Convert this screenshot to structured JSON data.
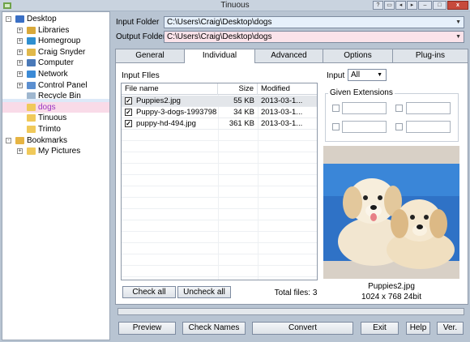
{
  "window": {
    "title": "Tinuous"
  },
  "tree": {
    "items": [
      {
        "label": "Desktop",
        "icon": "desktop-icon",
        "level": 0,
        "expander": "−"
      },
      {
        "label": "Libraries",
        "icon": "libraries-icon",
        "level": 1,
        "expander": "+"
      },
      {
        "label": "Homegroup",
        "icon": "homegroup-icon",
        "level": 1,
        "expander": "+"
      },
      {
        "label": "Craig Snyder",
        "icon": "user-folder-icon",
        "level": 1,
        "expander": "+"
      },
      {
        "label": "Computer",
        "icon": "computer-icon",
        "level": 1,
        "expander": "+"
      },
      {
        "label": "Network",
        "icon": "network-icon",
        "level": 1,
        "expander": "+"
      },
      {
        "label": "Control Panel",
        "icon": "control-panel-icon",
        "level": 1,
        "expander": "+"
      },
      {
        "label": "Recycle Bin",
        "icon": "recycle-bin-icon",
        "level": 1,
        "expander": ""
      },
      {
        "label": "dogs",
        "icon": "folder-icon",
        "level": 1,
        "expander": ""
      },
      {
        "label": "Tinuous",
        "icon": "folder-icon",
        "level": 1,
        "expander": ""
      },
      {
        "label": "Trimto",
        "icon": "folder-icon",
        "level": 1,
        "expander": ""
      },
      {
        "label": "Bookmarks",
        "icon": "bookmarks-icon",
        "level": 0,
        "expander": "−"
      },
      {
        "label": "My Pictures",
        "icon": "folder-icon",
        "level": 1,
        "expander": "+"
      }
    ]
  },
  "folders": {
    "input_label": "Input Folder",
    "input_value": "C:\\Users\\Craig\\Desktop\\dogs",
    "output_label": "Output Folder",
    "output_value": "C:\\Users\\Craig\\Desktop\\dogs"
  },
  "tabs": [
    "General",
    "Individual",
    "Advanced",
    "Options",
    "Plug-ins"
  ],
  "active_tab": "Individual",
  "files": {
    "group_label": "Input FIles",
    "columns": [
      "File name",
      "Size",
      "Modified"
    ],
    "rows": [
      {
        "name": "Puppies2.jpg",
        "size": "55 KB",
        "modified": "2013-03-1...",
        "checked": true
      },
      {
        "name": "Puppy-3-dogs-1993798...",
        "size": "34 KB",
        "modified": "2013-03-1...",
        "checked": true
      },
      {
        "name": "puppy-hd-494.jpg",
        "size": "361 KB",
        "modified": "2013-03-1...",
        "checked": true
      }
    ],
    "check_all": "Check all",
    "uncheck_all": "Uncheck all",
    "total": "Total files: 3"
  },
  "input_filter": {
    "label": "Input",
    "value": "All"
  },
  "extensions": {
    "legend": "Given Extensions"
  },
  "preview": {
    "filename": "Puppies2.jpg",
    "info": "1024 x 768  24bit"
  },
  "progress": 0,
  "buttons": {
    "preview": "Preview",
    "check_names": "Check Names",
    "convert": "Convert",
    "exit": "Exit",
    "help": "Help",
    "ver": "Ver."
  },
  "colors": {
    "accent": "#4a9de0",
    "selected_folder_text": "#9b36c2",
    "input_box": "#e6f0fb",
    "output_box": "#fbe3ea"
  }
}
